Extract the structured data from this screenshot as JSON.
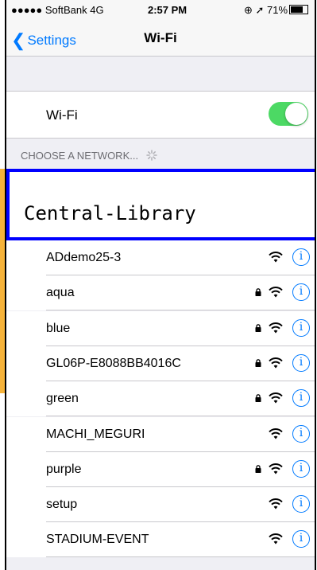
{
  "status_bar": {
    "carrier": "●●●●● SoftBank 4G",
    "time": "2:57 PM",
    "right": "⊕ ➚ 71%"
  },
  "nav": {
    "back_label": "Settings",
    "title": "Wi-Fi"
  },
  "wifi_toggle": {
    "label": "Wi-Fi",
    "on": true,
    "color": "#4cd964"
  },
  "section": {
    "header": "CHOOSE A NETWORK..."
  },
  "highlight": {
    "label": "Central-Library",
    "border_color": "#0000ff"
  },
  "networks": [
    {
      "name": "ADdemo25-3",
      "locked": false
    },
    {
      "name": "aqua",
      "locked": true
    },
    {
      "name": "blue",
      "locked": true
    },
    {
      "name": "GL06P-E8088BB4016C",
      "locked": true
    },
    {
      "name": "green",
      "locked": true
    },
    {
      "name": "MACHI_MEGURI",
      "locked": false
    },
    {
      "name": "purple",
      "locked": true
    },
    {
      "name": "setup",
      "locked": false
    },
    {
      "name": "STADIUM-EVENT",
      "locked": false
    }
  ],
  "colors": {
    "accent": "#007aff",
    "highlight_tab": "#f6b33a"
  }
}
